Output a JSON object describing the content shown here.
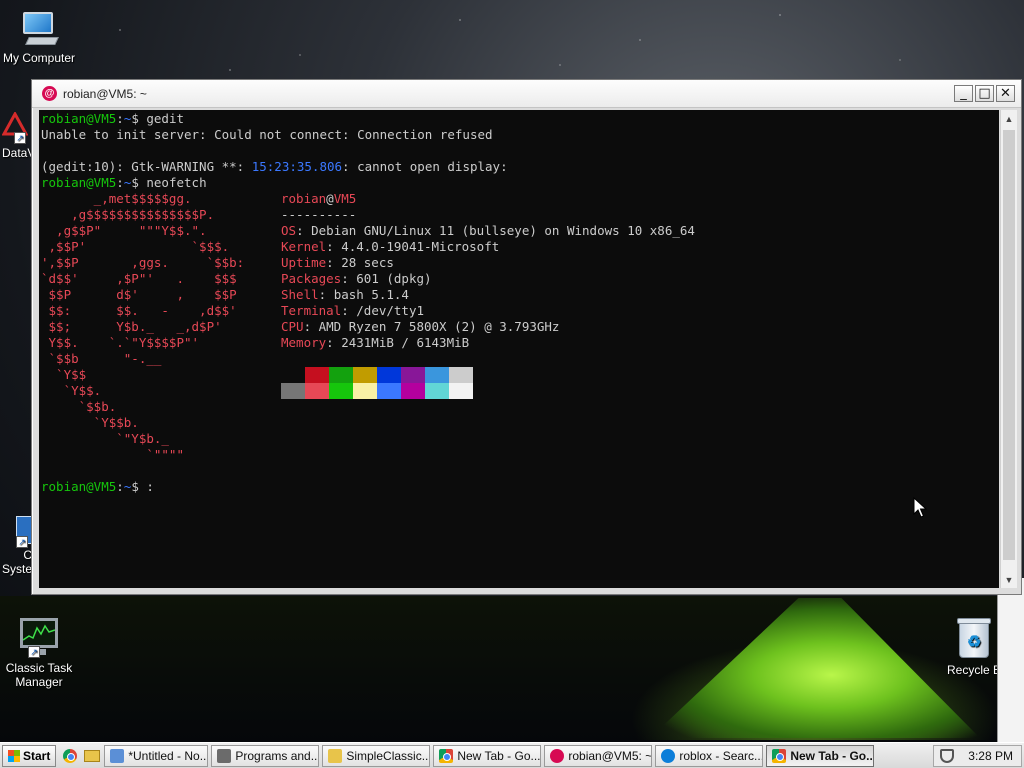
{
  "desktop": {
    "icons": {
      "my_computer": "My Computer",
      "classic_task_manager": "Classic Task\nManager",
      "recycle_bin": "Recycle B",
      "partial_datav": "DataV",
      "partial_c": "C",
      "partial_syste": "Syste"
    }
  },
  "window": {
    "title": "robian@VM5: ~",
    "buttons": {
      "minimize": "_",
      "maximize": "□",
      "close": "✕"
    }
  },
  "terminal": {
    "prompt_user": "robian@VM5",
    "prompt_path": ":~",
    "prompt_sign": "$",
    "cmd1": " gedit",
    "line_error": "Unable to init server: Could not connect: Connection refused",
    "warn_prefix": "(gedit:10): Gtk-WARNING **: ",
    "warn_time": "15:23:35.806",
    "warn_suffix": ": cannot open display:",
    "cmd2": " neofetch",
    "cmd3": " :",
    "logo_lines": [
      "       _,met$$$$$gg.",
      "    ,g$$$$$$$$$$$$$$$P.",
      "  ,g$$P\"     \"\"\"Y$$.\".",
      " ,$$P'              `$$$.",
      "',$$P       ,ggs.     `$$b:",
      "`d$$'     ,$P\"'   .    $$$",
      " $$P      d$'     ,    $$P",
      " $$:      $$.   -    ,d$$'",
      " $$;      Y$b._   _,d$P'",
      " Y$$.    `.`\"Y$$$$P\"'",
      " `$$b      \"-.__",
      "  `Y$$",
      "   `Y$$.",
      "     `$$b.",
      "       `Y$$b.",
      "          `\"Y$b._",
      "              `\"\"\"\""
    ],
    "info": {
      "user": "robian",
      "at": "@",
      "host": "VM5",
      "separator": "----------",
      "rows": [
        {
          "key": "OS",
          "value": ": Debian GNU/Linux 11 (bullseye) on Windows 10 x86_64"
        },
        {
          "key": "Kernel",
          "value": ": 4.4.0-19041-Microsoft"
        },
        {
          "key": "Uptime",
          "value": ": 28 secs"
        },
        {
          "key": "Packages",
          "value": ": 601 (dpkg)"
        },
        {
          "key": "Shell",
          "value": ": bash 5.1.4"
        },
        {
          "key": "Terminal",
          "value": ": /dev/tty1"
        },
        {
          "key": "CPU",
          "value": ": AMD Ryzen 7 5800X (2) @ 3.793GHz"
        },
        {
          "key": "Memory",
          "value": ": 2431MiB / 6143MiB"
        }
      ]
    },
    "palette_top": [
      "#0c0c0c",
      "#c50f1f",
      "#13a10e",
      "#c19c00",
      "#0037da",
      "#881798",
      "#3a96dd",
      "#cccccc"
    ],
    "palette_bottom": [
      "#767676",
      "#e74856",
      "#16c60c",
      "#f9f1a5",
      "#3b78ff",
      "#b4009e",
      "#61d6d6",
      "#f2f2f2"
    ]
  },
  "taskbar": {
    "start": "Start",
    "tasks": [
      {
        "label": "*Untitled - No...",
        "icon_color": "#5b8fd6",
        "icon": "notepad-icon"
      },
      {
        "label": "Programs and...",
        "icon_color": "#6b6b6b",
        "icon": "control-panel-icon"
      },
      {
        "label": "SimpleClassic...",
        "icon_color": "#e8c44a",
        "icon": "folder-icon"
      },
      {
        "label": "New Tab - Go...",
        "icon_color": "#4285f4",
        "icon": "chrome-icon"
      },
      {
        "label": "robian@VM5: ~",
        "icon_color": "#d70a53",
        "icon": "debian-icon"
      },
      {
        "label": "roblox - Searc...",
        "icon_color": "#0c7ed9",
        "icon": "edge-icon"
      },
      {
        "label": "New Tab - Go...",
        "icon_color": "#4285f4",
        "icon": "chrome-icon",
        "active": true
      }
    ],
    "clock": "3:28 PM"
  }
}
